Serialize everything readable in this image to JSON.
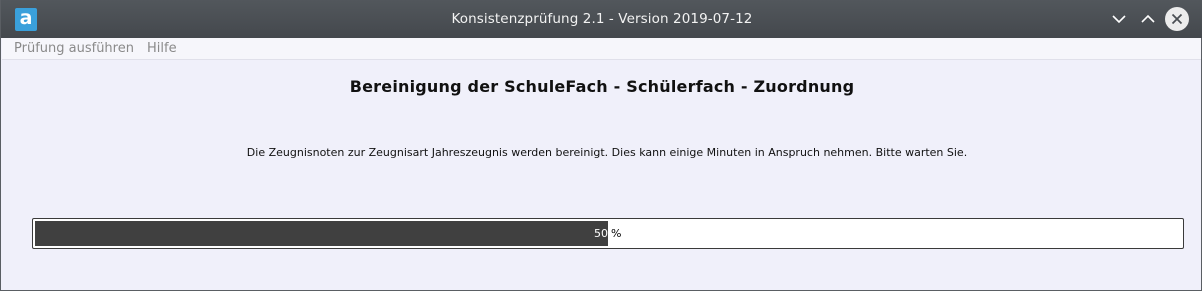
{
  "window": {
    "title": "Konsistenzprüfung 2.1 - Version 2019-07-12",
    "app_icon_letter": "a",
    "controls": [
      "minimize",
      "maximize",
      "close"
    ]
  },
  "menubar": {
    "items": [
      {
        "label": "Prüfung ausführen"
      },
      {
        "label": "Hilfe"
      }
    ]
  },
  "main": {
    "heading": "Bereinigung der SchuleFach - Schülerfach - Zuordnung",
    "message": "Die Zeugnisnoten zur Zeugnisart Jahreszeugnis werden bereinigt. Dies kann einige Minuten in Anspruch nehmen. Bitte warten Sie.",
    "progress": {
      "value": 50,
      "value_text": "50",
      "unit": "%"
    }
  },
  "colors": {
    "titlebar": "#4a4e53",
    "accent_icon": "#3aa0db",
    "window_bg": "#f0f0fa",
    "progress_fill": "#404040"
  },
  "icons": {
    "minimize": "chevron-down-icon",
    "maximize": "chevron-up-icon",
    "close": "close-icon"
  }
}
